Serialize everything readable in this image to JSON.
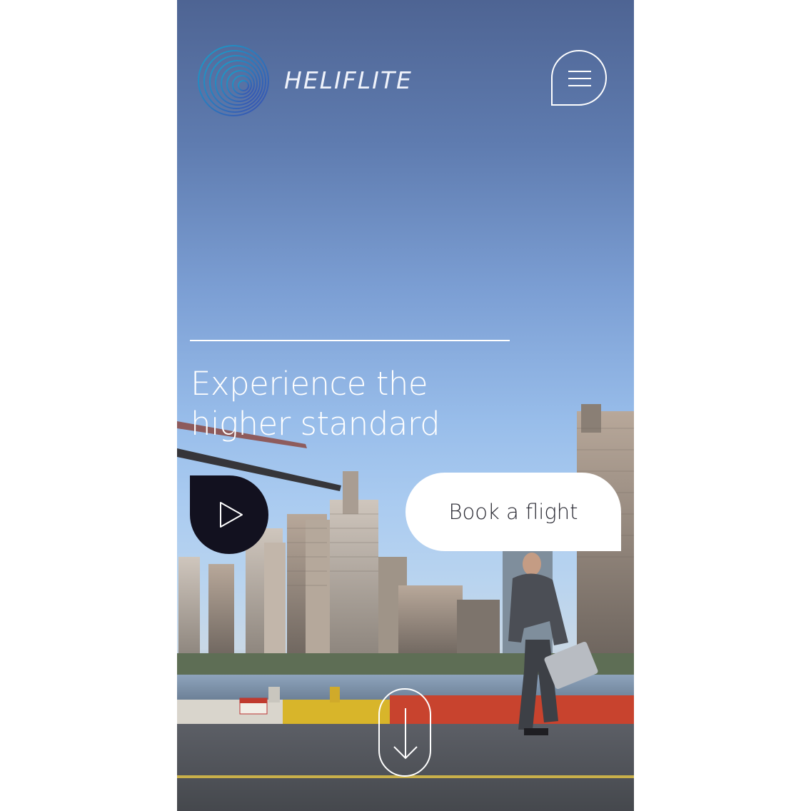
{
  "header": {
    "brand_name": "HELIFLITE",
    "logo_icon": "concentric-rings-logo-icon",
    "menu_icon": "hamburger-menu-icon"
  },
  "hero": {
    "headline": "Experience the higher standard",
    "play_icon": "play-icon",
    "book_button_label": "Book a flight",
    "scroll_icon": "arrow-down-icon",
    "background": "video-frame-helipad-city-skyline"
  },
  "colors": {
    "accent_dark": "#12111f",
    "logo_teal": "#1aa0c8",
    "logo_blue": "#3b4fb0",
    "text_light": "#ffffff"
  }
}
